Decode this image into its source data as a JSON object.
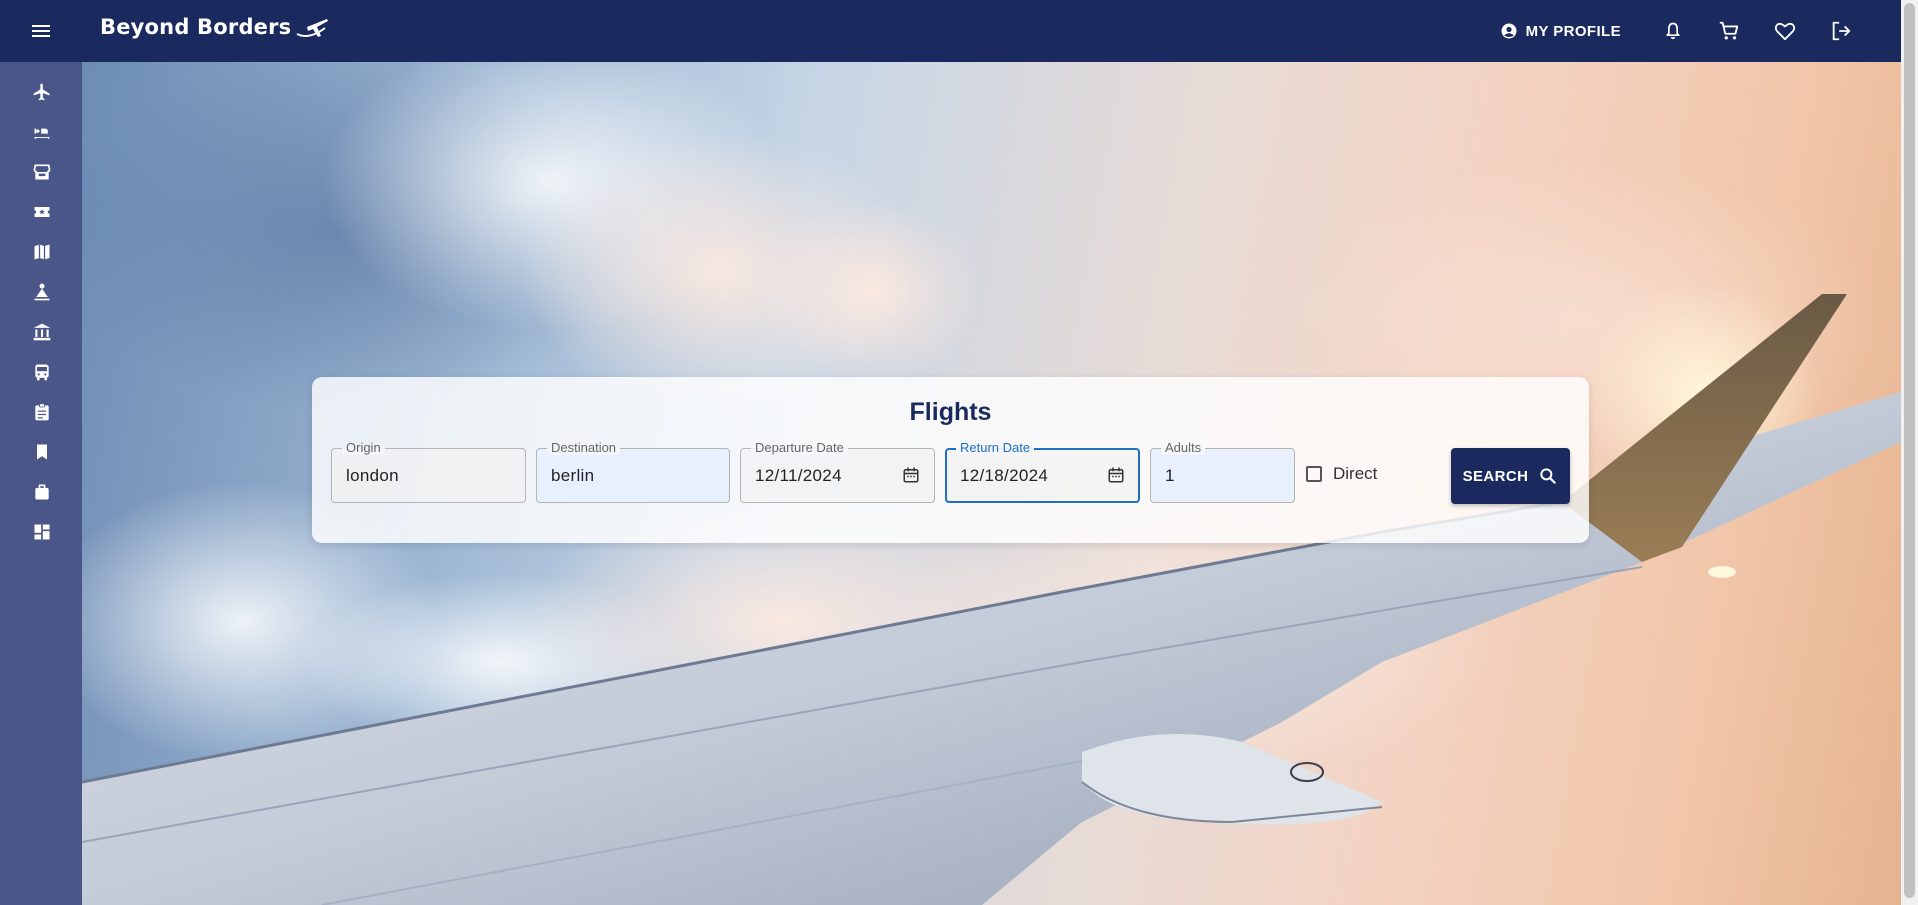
{
  "app": {
    "brand": "Beyond Borders"
  },
  "header": {
    "profile_label": "MY PROFILE",
    "icons": [
      "menu-icon",
      "account-circle-icon",
      "bell-icon",
      "cart-icon",
      "heart-icon",
      "logout-icon"
    ]
  },
  "sidebar": {
    "items": [
      {
        "icon": "flight-icon"
      },
      {
        "icon": "hotel-bed-icon"
      },
      {
        "icon": "store-icon"
      },
      {
        "icon": "ticket-star-icon"
      },
      {
        "icon": "map-icon"
      },
      {
        "icon": "attractions-icon"
      },
      {
        "icon": "museum-icon"
      },
      {
        "icon": "bus-icon"
      },
      {
        "icon": "clipboard-icon"
      },
      {
        "icon": "bookmark-icon"
      },
      {
        "icon": "luggage-icon"
      },
      {
        "icon": "dashboard-icon"
      }
    ]
  },
  "search": {
    "title": "Flights",
    "origin": {
      "label": "Origin",
      "value": "london"
    },
    "destination": {
      "label": "Destination",
      "value": "berlin"
    },
    "departure": {
      "label": "Departure Date",
      "value": "12/11/2024"
    },
    "return": {
      "label": "Return Date",
      "value": "12/18/2024"
    },
    "adults": {
      "label": "Adults",
      "value": "1"
    },
    "direct": {
      "label": "Direct",
      "checked": false
    },
    "button_label": "SEARCH"
  },
  "colors": {
    "primary": "#1b2a5e",
    "sidebar": "#4a5688",
    "focus": "#1f6fc5",
    "autofill": "#e8f0fe"
  }
}
